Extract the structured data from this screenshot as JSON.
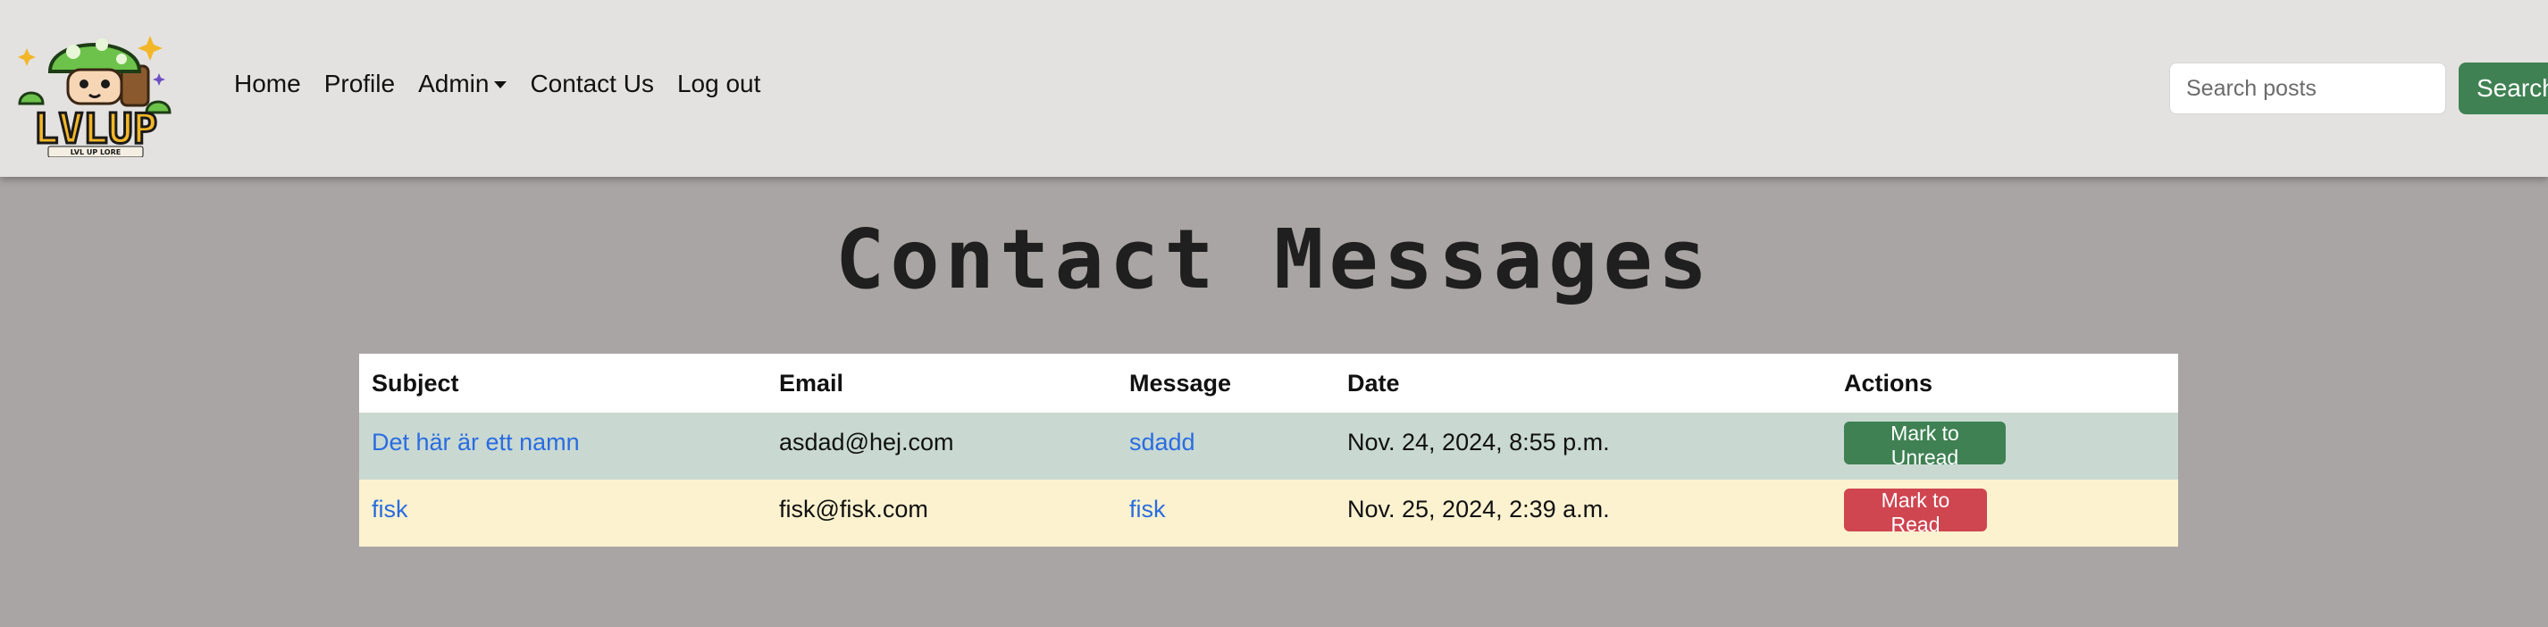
{
  "nav": {
    "logo_text": "LVLUP",
    "logo_subtext": "LVL UP LORE",
    "links": {
      "home": "Home",
      "profile": "Profile",
      "admin": "Admin",
      "contact": "Contact Us",
      "logout": "Log out"
    },
    "search": {
      "placeholder": "Search posts",
      "value": "",
      "button_label": "Search"
    }
  },
  "page": {
    "title": "Contact Messages"
  },
  "table": {
    "headers": {
      "subject": "Subject",
      "email": "Email",
      "message": "Message",
      "date": "Date",
      "actions": "Actions"
    },
    "rows": [
      {
        "subject": "Det här är ett namn",
        "email": "asdad@hej.com",
        "message": "sdadd",
        "date": "Nov. 24, 2024, 8:55 p.m.",
        "action_label": "Mark to Unread",
        "status": "read"
      },
      {
        "subject": "fisk",
        "email": "fisk@fisk.com",
        "message": "fisk",
        "date": "Nov. 25, 2024, 2:39 a.m.",
        "action_label": "Mark to Read",
        "status": "unread"
      }
    ]
  },
  "colors": {
    "navbar_bg": "#e3e2e0",
    "page_bg": "#a9a5a4",
    "link": "#2a6ce0",
    "success": "#3f8153",
    "danger": "#cf4550",
    "row_read_bg": "#c9d9d2",
    "row_unread_bg": "#fcf2cf"
  }
}
